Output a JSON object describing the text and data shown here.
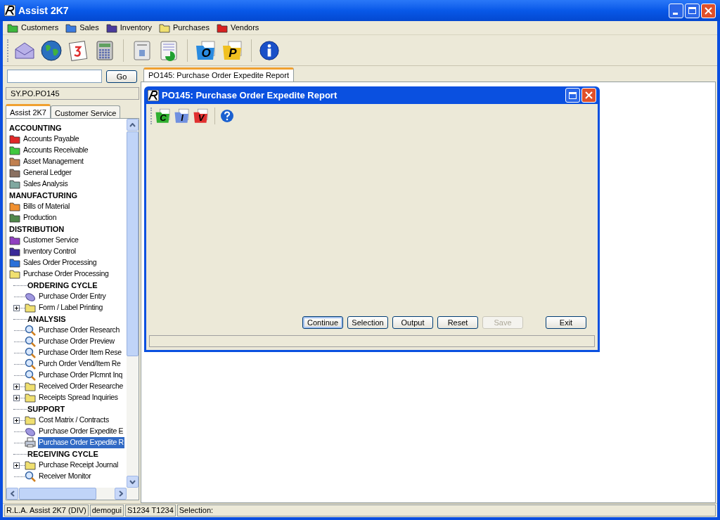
{
  "window": {
    "title": "Assist 2K7"
  },
  "menu": [
    {
      "label": "Customers",
      "color": "#3cb83c"
    },
    {
      "label": "Sales",
      "color": "#3a7be0"
    },
    {
      "label": "Inventory",
      "color": "#4a3a9c"
    },
    {
      "label": "Purchases",
      "color": "#f0e070"
    },
    {
      "label": "Vendors",
      "color": "#d82020"
    }
  ],
  "toolbar": [
    {
      "kind": "mail"
    },
    {
      "kind": "globe"
    },
    {
      "kind": "calendar"
    },
    {
      "kind": "calculator"
    },
    {
      "kind": "sep"
    },
    {
      "kind": "contact"
    },
    {
      "kind": "chart"
    },
    {
      "kind": "sep"
    },
    {
      "kind": "letter",
      "letter": "O",
      "color": "#2a8be0"
    },
    {
      "kind": "letter",
      "letter": "P",
      "color": "#f0c020"
    },
    {
      "kind": "sep"
    },
    {
      "kind": "info"
    }
  ],
  "search": {
    "button": "Go"
  },
  "path": "SY.PO.PO145",
  "side_tabs": [
    {
      "label": "Assist 2K7",
      "selected": true
    },
    {
      "label": "Customer Service",
      "selected": false
    }
  ],
  "tree": [
    {
      "kind": "section",
      "label": "ACCOUNTING"
    },
    {
      "kind": "folder",
      "label": "Accounts Payable",
      "color": "#e02828"
    },
    {
      "kind": "folder",
      "label": "Accounts Receivable",
      "color": "#40c840"
    },
    {
      "kind": "folder",
      "label": "Asset Management",
      "color": "#c08050"
    },
    {
      "kind": "folder",
      "label": "General Ledger",
      "color": "#8a7060"
    },
    {
      "kind": "folder",
      "label": "Sales Analysis",
      "color": "#80a8a0"
    },
    {
      "kind": "section",
      "label": "MANUFACTURING"
    },
    {
      "kind": "folder",
      "label": "Bills of Material",
      "color": "#f09030"
    },
    {
      "kind": "folder",
      "label": "Production",
      "color": "#50884a"
    },
    {
      "kind": "section",
      "label": "DISTRIBUTION"
    },
    {
      "kind": "folder",
      "label": "Customer Service",
      "color": "#9040c0"
    },
    {
      "kind": "folder",
      "label": "Inventory Control",
      "color": "#3a2a98"
    },
    {
      "kind": "folder",
      "label": "Sales Order Processing",
      "color": "#2a70d8"
    },
    {
      "kind": "folder",
      "label": "Purchase Order Processing",
      "color": "#f0e070",
      "children": [
        {
          "kind": "section",
          "label": "ORDERING CYCLE",
          "children": [
            {
              "kind": "form",
              "label": "Purchase Order Entry",
              "selected": false
            },
            {
              "kind": "folder",
              "label": "Form / Label Printing",
              "color": "#f0e070",
              "expanded": false
            }
          ]
        },
        {
          "kind": "section",
          "label": "ANALYSIS",
          "children": [
            {
              "kind": "search",
              "label": "Purchase Order Research",
              "selected": false
            },
            {
              "kind": "search",
              "label": "Purchase Order Preview",
              "selected": false
            },
            {
              "kind": "search",
              "label": "Purchase Order Item Rese",
              "selected": false
            },
            {
              "kind": "search",
              "label": "Purch Order Vend/Item Re",
              "selected": false
            },
            {
              "kind": "search",
              "label": "Purchase Order Plcmnt Inq",
              "selected": false
            },
            {
              "kind": "folder",
              "label": "Received Order Researche",
              "color": "#f0e070",
              "expanded": false
            },
            {
              "kind": "folder",
              "label": "Receipts Spread Inquiries",
              "color": "#f0e070",
              "expanded": false
            }
          ]
        },
        {
          "kind": "section",
          "label": "SUPPORT",
          "children": [
            {
              "kind": "folder",
              "label": "Cost Matrix / Contracts",
              "color": "#f0e070",
              "expanded": false
            },
            {
              "kind": "form",
              "label": "Purchase Order Expedite E",
              "selected": false
            },
            {
              "kind": "printer",
              "label": "Purchase Order Expedite R",
              "selected": true
            }
          ]
        },
        {
          "kind": "section",
          "label": "RECEIVING CYCLE",
          "children": [
            {
              "kind": "folder",
              "label": "Purchase Receipt Journal",
              "color": "#f0e070",
              "expanded": false
            },
            {
              "kind": "search",
              "label": "Receiver Monitor",
              "selected": false
            }
          ]
        }
      ]
    }
  ],
  "doc_tab": {
    "label": "PO145: Purchase Order Expedite Report",
    "selected": true
  },
  "dialog": {
    "title": "PO145: Purchase Order Expedite Report",
    "toolbar": [
      {
        "kind": "letter",
        "letter": "C",
        "color": "#30b030"
      },
      {
        "kind": "letter",
        "letter": "I",
        "color": "#7090e0"
      },
      {
        "kind": "letter",
        "letter": "V",
        "color": "#e03030"
      },
      {
        "kind": "sep"
      },
      {
        "kind": "help"
      }
    ],
    "buttons": [
      {
        "label": "Continue",
        "disabled": false,
        "default": true
      },
      {
        "label": "Selection",
        "disabled": false,
        "default": false
      },
      {
        "label": "Output",
        "disabled": false,
        "default": false
      },
      {
        "label": "Reset",
        "disabled": false,
        "default": false
      },
      {
        "label": "Save",
        "disabled": true,
        "default": false
      },
      {
        "label": "Exit",
        "disabled": false,
        "default": false
      }
    ]
  },
  "status_bar": [
    "R.L.A. Assist 2K7 (DIV)",
    "demogui",
    "S1234 T1234",
    "Selection:"
  ]
}
